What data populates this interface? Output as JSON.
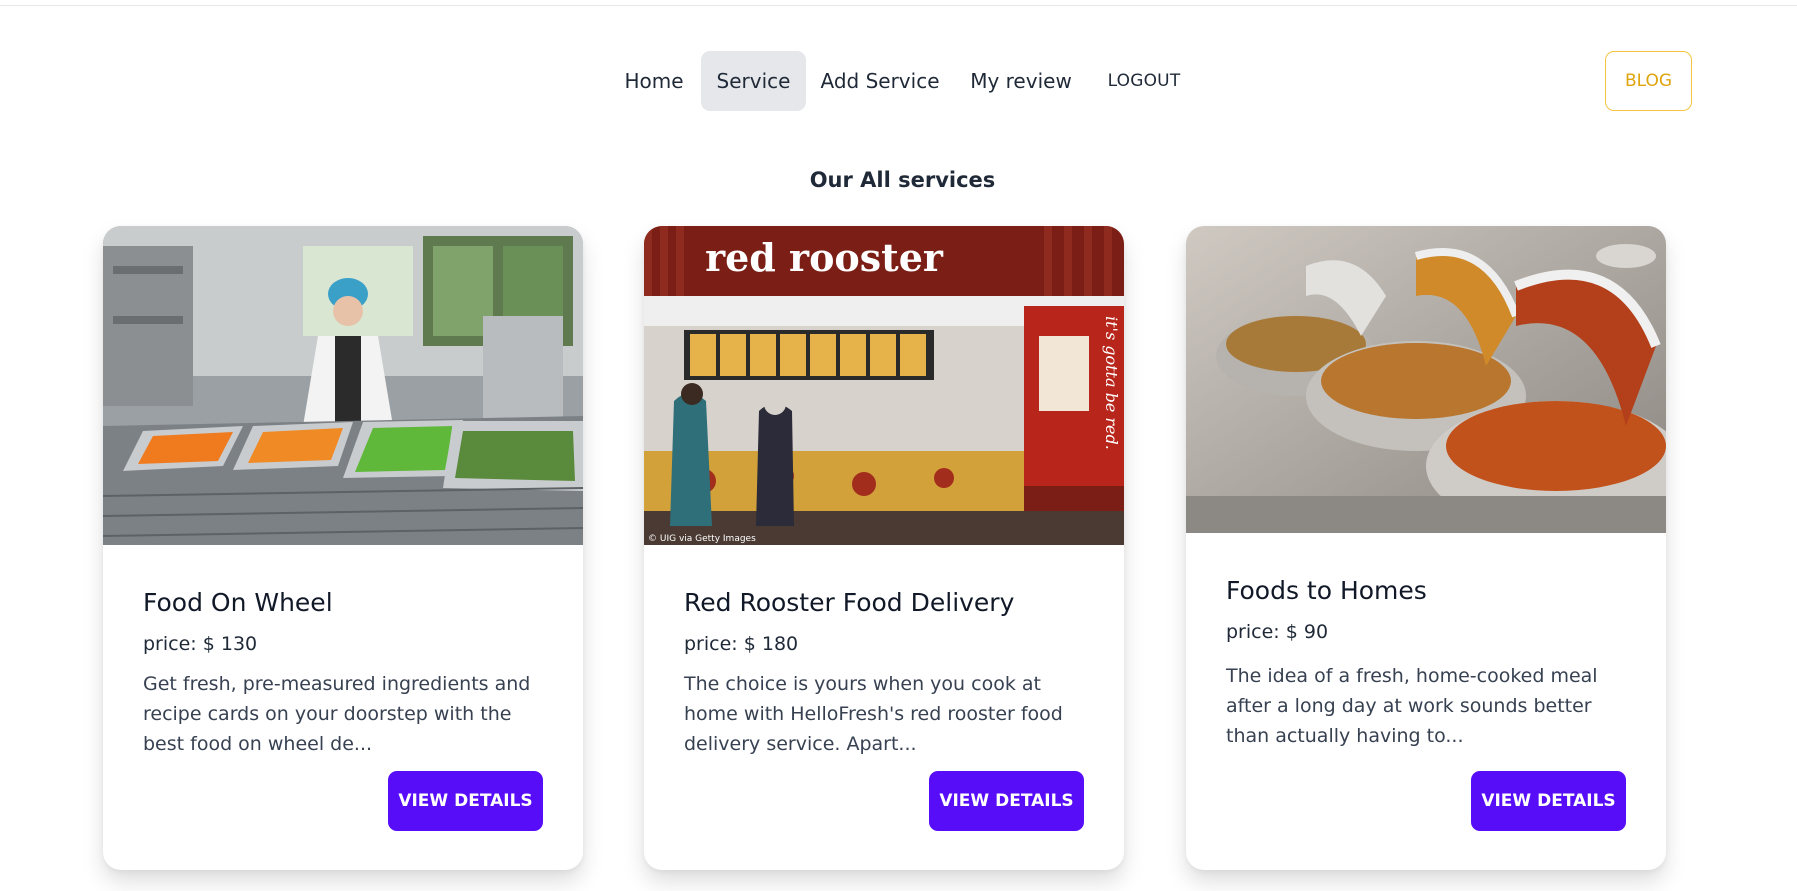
{
  "nav": {
    "items": [
      {
        "label": "Home"
      },
      {
        "label": "Service"
      },
      {
        "label": "Add Service"
      },
      {
        "label": "My review"
      },
      {
        "label": "LOGOUT"
      }
    ],
    "active": "Service",
    "blog_label": "BLOG"
  },
  "section_title": "Our All services",
  "services": [
    {
      "title": "Food On Wheel",
      "price": "price: $ 130",
      "description": "Get fresh, pre-measured ingredients and recipe cards on your doorstep with the best food on wheel de...",
      "button": "VIEW DETAILS",
      "image_alt": "commercial kitchen with chef"
    },
    {
      "title": "Red Rooster Food Delivery",
      "price": "price: $ 180",
      "description": "The choice is yours when you cook at home with HelloFresh's red rooster food delivery service. Apart...",
      "button": "VIEW DETAILS",
      "image_alt": "red rooster restaurant counter",
      "image_sign": "red rooster",
      "image_wall_text": "it's gotta be red.",
      "image_credit": "© UIG via Getty Images"
    },
    {
      "title": "Foods to Homes",
      "price": "price: $ 90",
      "description": "The idea of a fresh, home-cooked meal after a long day at work sounds better than actually having to...",
      "button": "VIEW DETAILS",
      "image_alt": "buffet chafing dishes"
    }
  ],
  "colors": {
    "primary": "#570df8",
    "accent": "#f5c542",
    "active_bg": "#e5e7eb"
  }
}
